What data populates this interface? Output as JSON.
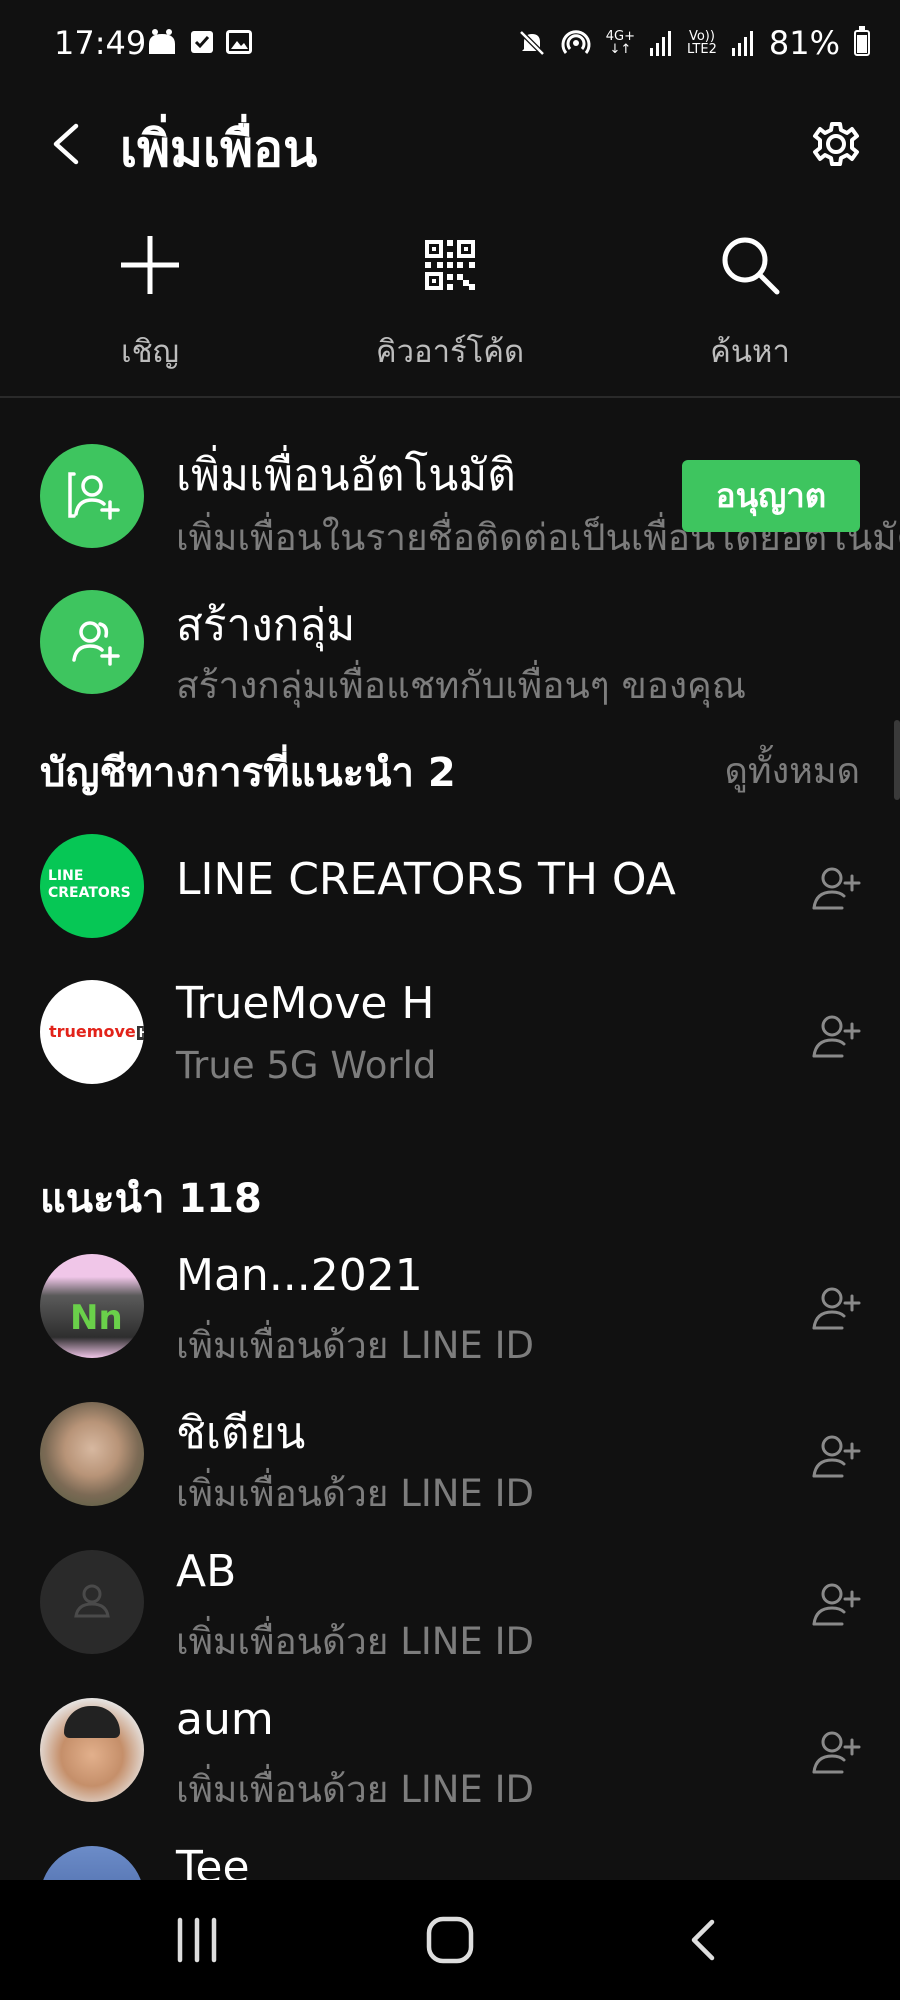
{
  "status_bar": {
    "time": "17:49",
    "network_top": "4G+",
    "volte_top": "Vo))",
    "volte_bottom": "LTE2",
    "battery": "81%",
    "battery_level": 0.81
  },
  "header": {
    "title": "เพิ่มเพื่อน"
  },
  "actions": [
    {
      "label": "เชิญ",
      "icon": "plus-icon"
    },
    {
      "label": "คิวอาร์โค้ด",
      "icon": "qr-code-icon"
    },
    {
      "label": "ค้นหา",
      "icon": "search-icon"
    }
  ],
  "auto_add": {
    "title": "เพิ่มเพื่อนอัตโนมัติ",
    "subtitle": "เพิ่มเพื่อนในรายชื่อติดต่อเป็นเพื่อนโดยอัตโนมัติ",
    "button": "อนุญาต"
  },
  "create_group": {
    "title": "สร้างกลุ่ม",
    "subtitle": "สร้างกลุ่มเพื่อแชทกับเพื่อนๆ ของคุณ"
  },
  "official": {
    "header": "บัญชีทางการที่แนะนำ 2",
    "see_all": "ดูทั้งหมด",
    "items": [
      {
        "name": "LINE CREATORS TH OA",
        "subtitle": "",
        "logo_line1": "LINE",
        "logo_line2": "CREATORS"
      },
      {
        "name": "TrueMove H",
        "subtitle": "True 5G World",
        "logo_text": "truemove",
        "logo_badge": "H"
      }
    ]
  },
  "recommended": {
    "header": "แนะนำ 118",
    "items": [
      {
        "name": "Man...2021",
        "subtitle": "เพิ่มเพื่อนด้วย LINE ID"
      },
      {
        "name": "ชิเตียน",
        "subtitle": "เพิ่มเพื่อนด้วย LINE ID"
      },
      {
        "name": "AB",
        "subtitle": "เพิ่มเพื่อนด้วย LINE ID"
      },
      {
        "name": "aum",
        "subtitle": "เพิ่มเพื่อนด้วย LINE ID"
      },
      {
        "name": "Tee",
        "subtitle": ""
      }
    ]
  },
  "colors": {
    "background": "#111111",
    "accent_green": "#3ec55f",
    "secondary_text": "#7d7d7d"
  }
}
